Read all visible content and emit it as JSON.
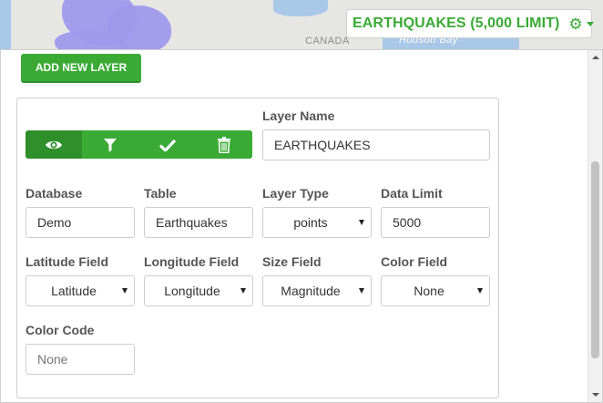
{
  "map": {
    "labels": [
      "CANADA",
      "Hudson Bay"
    ]
  },
  "header": {
    "title": "EARTHQUAKES (5,000 LIMIT)",
    "gear_icon": "gear-icon",
    "caret_icon": "caret-down-icon",
    "accent_color": "#3aaa35"
  },
  "panel": {
    "add_layer_label": "ADD NEW LAYER",
    "toolbar": {
      "icons": [
        "eye-icon",
        "filter-icon",
        "checkmark-icon",
        "trash-icon"
      ],
      "active_index": 0
    },
    "fields": {
      "layer_name": {
        "label": "Layer Name",
        "value": "EARTHQUAKES"
      },
      "database": {
        "label": "Database",
        "value": "Demo"
      },
      "table": {
        "label": "Table",
        "value": "Earthquakes"
      },
      "layer_type": {
        "label": "Layer Type",
        "value": "points"
      },
      "data_limit": {
        "label": "Data Limit",
        "value": "5000"
      },
      "latitude_field": {
        "label": "Latitude Field",
        "value": "Latitude"
      },
      "longitude_field": {
        "label": "Longitude Field",
        "value": "Longitude"
      },
      "size_field": {
        "label": "Size Field",
        "value": "Magnitude"
      },
      "color_field": {
        "label": "Color Field",
        "value": "None"
      },
      "color_code": {
        "label": "Color Code",
        "placeholder": "None"
      }
    }
  }
}
